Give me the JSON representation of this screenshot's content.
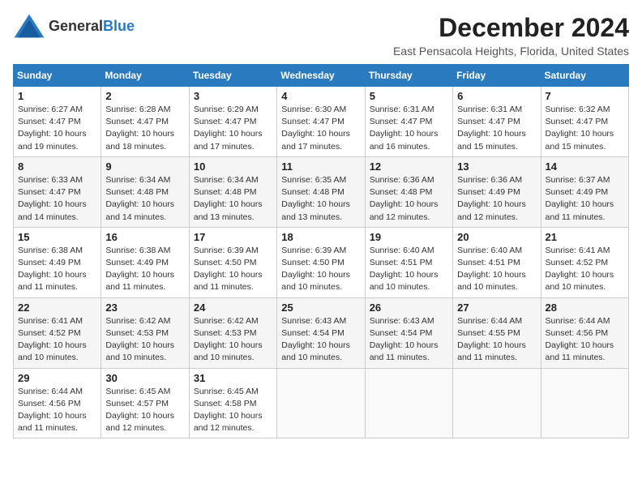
{
  "header": {
    "logo_general": "General",
    "logo_blue": "Blue",
    "title": "December 2024",
    "subtitle": "East Pensacola Heights, Florida, United States"
  },
  "calendar": {
    "days_of_week": [
      "Sunday",
      "Monday",
      "Tuesday",
      "Wednesday",
      "Thursday",
      "Friday",
      "Saturday"
    ],
    "weeks": [
      [
        null,
        {
          "day": 2,
          "sunrise": "6:28 AM",
          "sunset": "4:47 PM",
          "daylight": "10 hours and 18 minutes."
        },
        {
          "day": 3,
          "sunrise": "6:29 AM",
          "sunset": "4:47 PM",
          "daylight": "10 hours and 17 minutes."
        },
        {
          "day": 4,
          "sunrise": "6:30 AM",
          "sunset": "4:47 PM",
          "daylight": "10 hours and 17 minutes."
        },
        {
          "day": 5,
          "sunrise": "6:31 AM",
          "sunset": "4:47 PM",
          "daylight": "10 hours and 16 minutes."
        },
        {
          "day": 6,
          "sunrise": "6:31 AM",
          "sunset": "4:47 PM",
          "daylight": "10 hours and 15 minutes."
        },
        {
          "day": 7,
          "sunrise": "6:32 AM",
          "sunset": "4:47 PM",
          "daylight": "10 hours and 15 minutes."
        }
      ],
      [
        {
          "day": 1,
          "sunrise": "6:27 AM",
          "sunset": "4:47 PM",
          "daylight": "10 hours and 19 minutes."
        },
        null,
        null,
        null,
        null,
        null,
        null
      ],
      [
        {
          "day": 8,
          "sunrise": "6:33 AM",
          "sunset": "4:47 PM",
          "daylight": "10 hours and 14 minutes."
        },
        {
          "day": 9,
          "sunrise": "6:34 AM",
          "sunset": "4:48 PM",
          "daylight": "10 hours and 14 minutes."
        },
        {
          "day": 10,
          "sunrise": "6:34 AM",
          "sunset": "4:48 PM",
          "daylight": "10 hours and 13 minutes."
        },
        {
          "day": 11,
          "sunrise": "6:35 AM",
          "sunset": "4:48 PM",
          "daylight": "10 hours and 13 minutes."
        },
        {
          "day": 12,
          "sunrise": "6:36 AM",
          "sunset": "4:48 PM",
          "daylight": "10 hours and 12 minutes."
        },
        {
          "day": 13,
          "sunrise": "6:36 AM",
          "sunset": "4:49 PM",
          "daylight": "10 hours and 12 minutes."
        },
        {
          "day": 14,
          "sunrise": "6:37 AM",
          "sunset": "4:49 PM",
          "daylight": "10 hours and 11 minutes."
        }
      ],
      [
        {
          "day": 15,
          "sunrise": "6:38 AM",
          "sunset": "4:49 PM",
          "daylight": "10 hours and 11 minutes."
        },
        {
          "day": 16,
          "sunrise": "6:38 AM",
          "sunset": "4:49 PM",
          "daylight": "10 hours and 11 minutes."
        },
        {
          "day": 17,
          "sunrise": "6:39 AM",
          "sunset": "4:50 PM",
          "daylight": "10 hours and 11 minutes."
        },
        {
          "day": 18,
          "sunrise": "6:39 AM",
          "sunset": "4:50 PM",
          "daylight": "10 hours and 10 minutes."
        },
        {
          "day": 19,
          "sunrise": "6:40 AM",
          "sunset": "4:51 PM",
          "daylight": "10 hours and 10 minutes."
        },
        {
          "day": 20,
          "sunrise": "6:40 AM",
          "sunset": "4:51 PM",
          "daylight": "10 hours and 10 minutes."
        },
        {
          "day": 21,
          "sunrise": "6:41 AM",
          "sunset": "4:52 PM",
          "daylight": "10 hours and 10 minutes."
        }
      ],
      [
        {
          "day": 22,
          "sunrise": "6:41 AM",
          "sunset": "4:52 PM",
          "daylight": "10 hours and 10 minutes."
        },
        {
          "day": 23,
          "sunrise": "6:42 AM",
          "sunset": "4:53 PM",
          "daylight": "10 hours and 10 minutes."
        },
        {
          "day": 24,
          "sunrise": "6:42 AM",
          "sunset": "4:53 PM",
          "daylight": "10 hours and 10 minutes."
        },
        {
          "day": 25,
          "sunrise": "6:43 AM",
          "sunset": "4:54 PM",
          "daylight": "10 hours and 10 minutes."
        },
        {
          "day": 26,
          "sunrise": "6:43 AM",
          "sunset": "4:54 PM",
          "daylight": "10 hours and 11 minutes."
        },
        {
          "day": 27,
          "sunrise": "6:44 AM",
          "sunset": "4:55 PM",
          "daylight": "10 hours and 11 minutes."
        },
        {
          "day": 28,
          "sunrise": "6:44 AM",
          "sunset": "4:56 PM",
          "daylight": "10 hours and 11 minutes."
        }
      ],
      [
        {
          "day": 29,
          "sunrise": "6:44 AM",
          "sunset": "4:56 PM",
          "daylight": "10 hours and 11 minutes."
        },
        {
          "day": 30,
          "sunrise": "6:45 AM",
          "sunset": "4:57 PM",
          "daylight": "10 hours and 12 minutes."
        },
        {
          "day": 31,
          "sunrise": "6:45 AM",
          "sunset": "4:58 PM",
          "daylight": "10 hours and 12 minutes."
        },
        null,
        null,
        null,
        null
      ]
    ]
  }
}
